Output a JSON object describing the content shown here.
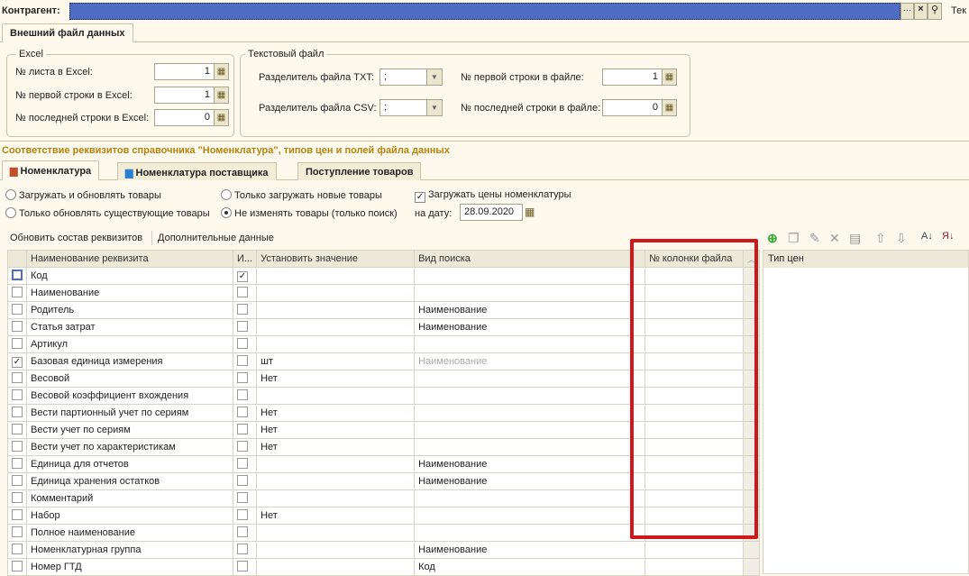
{
  "header": {
    "counterparty_label": "Контрагент:",
    "right_label": "Тек"
  },
  "file_tab": "Внешний файл данных",
  "excel": {
    "title": "Excel",
    "sheet_label": "№ листа в Excel:",
    "sheet_value": "1",
    "first_row_label": "№ первой строки в Excel:",
    "first_row_value": "1",
    "last_row_label": "№ последней строки в Excel:",
    "last_row_value": "0"
  },
  "text_file": {
    "title": "Текстовый файл",
    "txt_sep_label": "Разделитель файла TXT:",
    "txt_sep_value": ";",
    "csv_sep_label": "Разделитель файла CSV:",
    "csv_sep_value": ";",
    "first_row_label": "№ первой строки в файле:",
    "first_row_value": "1",
    "last_row_label": "№ последней строки в файле:",
    "last_row_value": "0"
  },
  "section_title": "Соответствие реквизитов справочника \"Номенклатура\", типов цен и полей файла данных",
  "tabs": [
    {
      "label": "Номенклатура",
      "active": true
    },
    {
      "label": "Номенклатура поставщика"
    },
    {
      "label": "Поступление товаров"
    }
  ],
  "options": {
    "r1": "Загружать и обновлять товары",
    "r2": "Только обновлять существующие товары",
    "r3": "Только загружать новые товары",
    "r4": "Не изменять товары (только поиск)",
    "selected": "r4",
    "load_prices": "Загружать цены номенклатуры",
    "load_prices_checked": true,
    "date_label": "на дату:",
    "date_value": "28.09.2020"
  },
  "toolbar": {
    "refresh": "Обновить состав реквизитов",
    "extra": "Дополнительные данные"
  },
  "grid": {
    "columns": [
      "Наименование реквизита",
      "И...",
      "Установить значение",
      "Вид поиска",
      "№ колонки файла"
    ],
    "rows": [
      {
        "name": "Код",
        "use": false,
        "key": true,
        "value": "",
        "search": "",
        "col": ""
      },
      {
        "name": "Наименование",
        "use": false,
        "key": false,
        "value": "",
        "search": "",
        "col": ""
      },
      {
        "name": "Родитель",
        "use": false,
        "key": false,
        "value": "",
        "search": "Наименование",
        "col": ""
      },
      {
        "name": "Статья затрат",
        "use": false,
        "key": false,
        "value": "",
        "search": "Наименование",
        "col": ""
      },
      {
        "name": "Артикул",
        "use": false,
        "key": false,
        "value": "",
        "search": "",
        "col": ""
      },
      {
        "name": "Базовая единица измерения",
        "use": true,
        "key": false,
        "value": "шт",
        "search": "Наименование",
        "search_grey": true,
        "col": ""
      },
      {
        "name": "Весовой",
        "use": false,
        "key": false,
        "value": "Нет",
        "search": "",
        "col": ""
      },
      {
        "name": "Весовой коэффициент вхождения",
        "use": false,
        "key": false,
        "value": "",
        "search": "",
        "col": ""
      },
      {
        "name": "Вести партионный учет по сериям",
        "use": false,
        "key": false,
        "value": "Нет",
        "search": "",
        "col": ""
      },
      {
        "name": "Вести учет по сериям",
        "use": false,
        "key": false,
        "value": "Нет",
        "search": "",
        "col": ""
      },
      {
        "name": "Вести учет по характеристикам",
        "use": false,
        "key": false,
        "value": "Нет",
        "search": "",
        "col": ""
      },
      {
        "name": "Единица для отчетов",
        "use": false,
        "key": false,
        "value": "",
        "search": "Наименование",
        "col": ""
      },
      {
        "name": "Единица хранения остатков",
        "use": false,
        "key": false,
        "value": "",
        "search": "Наименование",
        "col": ""
      },
      {
        "name": "Комментарий",
        "use": false,
        "key": false,
        "value": "",
        "search": "",
        "col": ""
      },
      {
        "name": "Набор",
        "use": false,
        "key": false,
        "value": "Нет",
        "search": "",
        "col": ""
      },
      {
        "name": "Полное наименование",
        "use": false,
        "key": false,
        "value": "",
        "search": "",
        "col": ""
      },
      {
        "name": "Номенклатурная группа",
        "use": false,
        "key": false,
        "value": "",
        "search": "Наименование",
        "col": ""
      },
      {
        "name": "Номер ГТД",
        "use": false,
        "key": false,
        "value": "",
        "search": "Код",
        "col": ""
      }
    ]
  },
  "price_panel": {
    "column": "Тип цен"
  },
  "highlight_color": "#d0171b",
  "selection_color": "#4f6cc4"
}
